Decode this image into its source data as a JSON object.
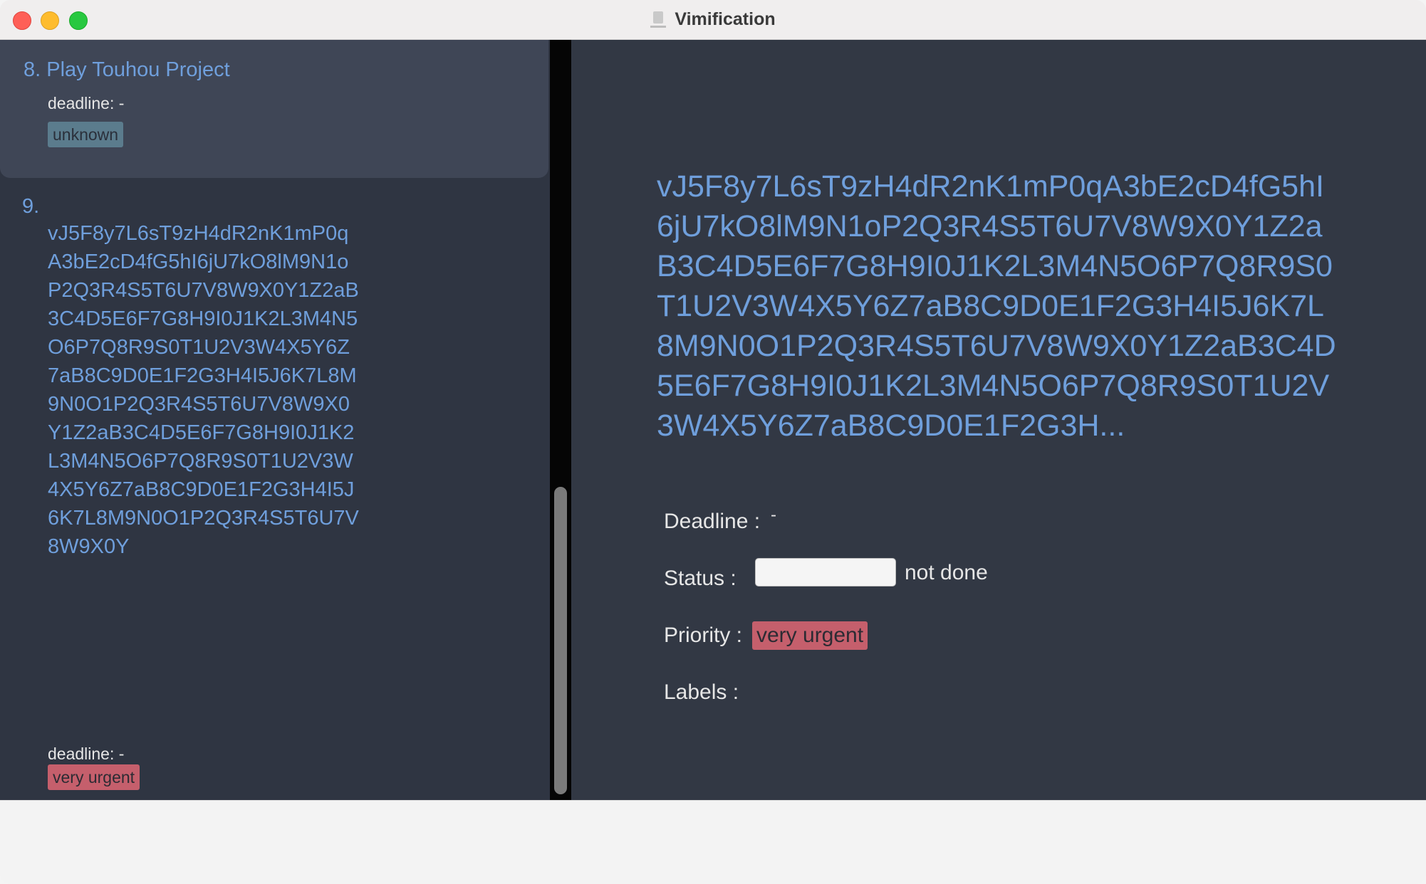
{
  "window": {
    "title": "Vimification"
  },
  "task_list": [
    {
      "number": "8.",
      "title": "Play Touhou Project",
      "deadline": "deadline: -",
      "tag": "unknown"
    },
    {
      "number": "9.",
      "title": "vJ5F8y7L6sT9zH4dR2nK1mP0qA3bE2cD4fG5hI6jU7kO8lM9N1oP2Q3R4S5T6U7V8W9X0Y1Z2aB3C4D5E6F7G8H9I0J1K2L3M4N5O6P7Q8R9S0T1U2V3W4X5Y6Z7aB8C9D0E1F2G3H4I5J6K7L8M9N0O1P2Q3R4S5T6U7V8W9X0Y1Z2aB3C4D5E6F7G8H9I0J1K2L3M4N5O6P7Q8R9S0T1U2V3W4X5Y6Z7aB8C9D0E1F2G3H4I5J6K7L8M9N0O1P2Q3R4S5T6U7V8W9X0Y",
      "deadline": "deadline: -",
      "tag": "very urgent"
    }
  ],
  "detail": {
    "title": "vJ5F8y7L6sT9zH4dR2nK1mP0qA3bE2cD4fG5hI6jU7kO8lM9N1oP2Q3R4S5T6U7V8W9X0Y1Z2aB3C4D5E6F7G8H9I0J1K2L3M4N5O6P7Q8R9S0T1U2V3W4X5Y6Z7aB8C9D0E1F2G3H4I5J6K7L8M9N0O1P2Q3R4S5T6U7V8W9X0Y1Z2aB3C4D5E6F7G8H9I0J1K2L3M4N5O6P7Q8R9S0T1U2V3W4X5Y6Z7aB8C9D0E1F2G3H...",
    "deadline_label": "Deadline :",
    "deadline_value": "-",
    "status_label": "Status :",
    "status_value": "not done",
    "priority_label": "Priority :",
    "priority_value": "very urgent",
    "labels_label": "Labels :"
  },
  "colors": {
    "title_blue": "#6f9fdc",
    "panel_bg": "#2f3542",
    "selected_card_bg": "#3f4656",
    "urgent_tag": "#c55f6c",
    "unknown_tag": "#5b7c8d"
  },
  "icons": [
    "close-button",
    "minimize-button",
    "maximize-button",
    "app-icon"
  ]
}
